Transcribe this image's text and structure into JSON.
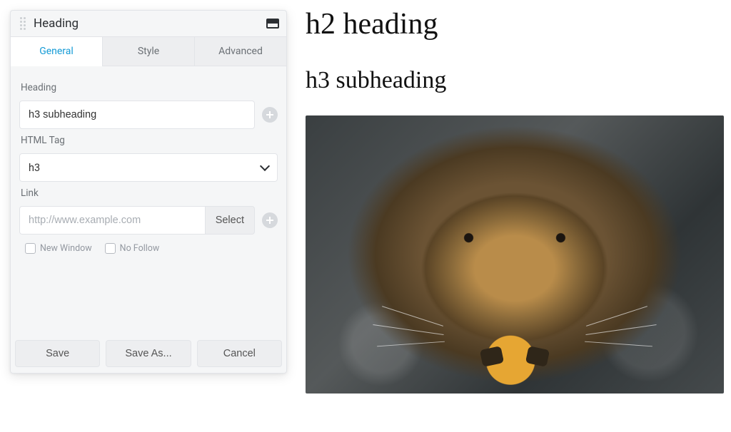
{
  "panel": {
    "title": "Heading",
    "tabs": {
      "general": "General",
      "style": "Style",
      "advanced": "Advanced"
    },
    "fields": {
      "heading_label": "Heading",
      "heading_value": "h3 subheading",
      "htmltag_label": "HTML Tag",
      "htmltag_value": "h3",
      "link_label": "Link",
      "link_placeholder": "http://www.example.com",
      "link_select": "Select",
      "new_window": "New Window",
      "no_follow": "No Follow"
    },
    "footer": {
      "save": "Save",
      "save_as": "Save As...",
      "cancel": "Cancel"
    }
  },
  "preview": {
    "h2": "h2 heading",
    "h3": "h3 subheading"
  }
}
